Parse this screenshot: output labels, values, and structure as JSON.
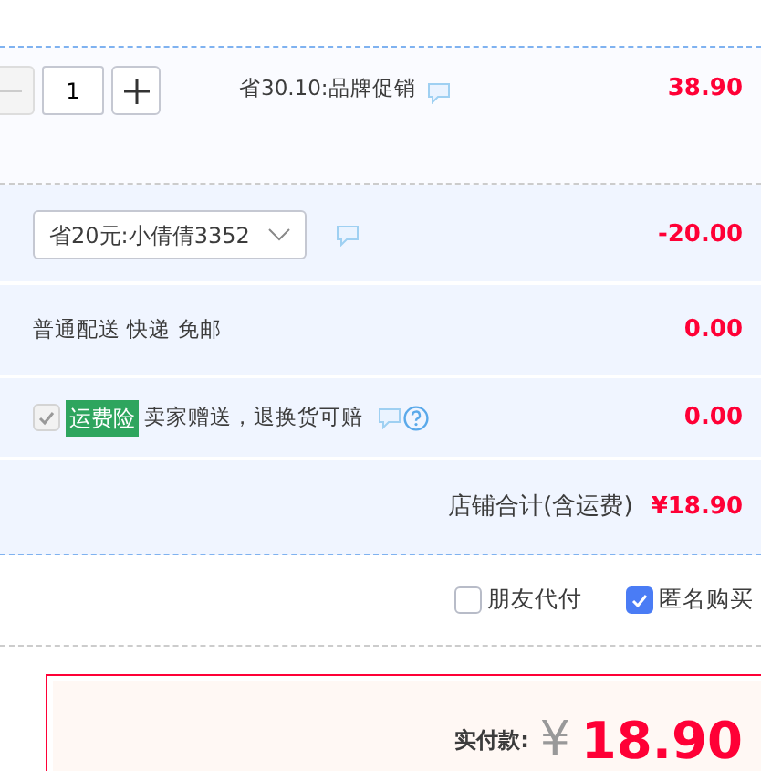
{
  "item": {
    "quantity": {
      "value": "1",
      "decrease_disabled": true
    },
    "promotion": "省30.10:品牌促销",
    "price": "38.90"
  },
  "coupon": {
    "selected_value": "省20元:小倩倩3352",
    "amount": "-20.00"
  },
  "shipping": {
    "label": "普通配送 快递 免邮",
    "amount": "0.00"
  },
  "insurance": {
    "checked": true,
    "disabled": true,
    "tag": "运费险",
    "description": "卖家赠送，退换货可赔",
    "amount": "0.00"
  },
  "store_total": {
    "label": "店铺合计(含运费)",
    "amount": "¥18.90"
  },
  "options": [
    {
      "label": "朋友代付",
      "checked": false
    },
    {
      "label": "匿名购买",
      "checked": true
    }
  ],
  "payment": {
    "label": "实付款:",
    "currency": "¥",
    "amount": "18.90"
  }
}
